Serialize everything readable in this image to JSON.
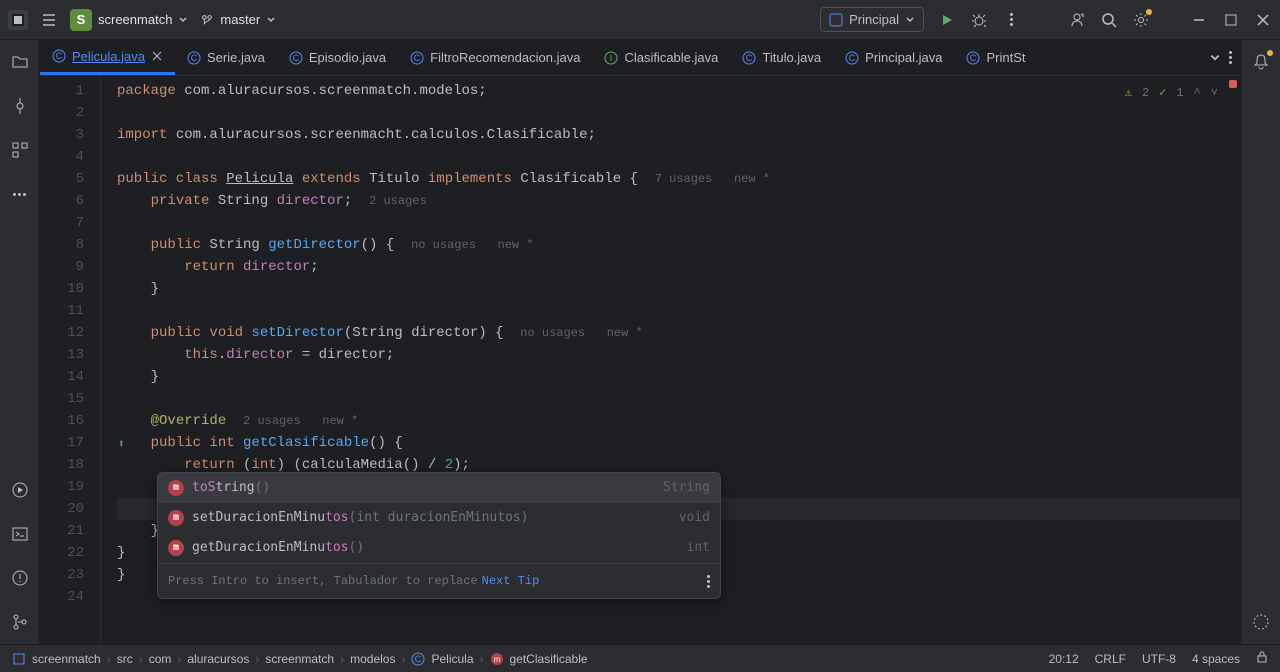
{
  "titlebar": {
    "project_letter": "S",
    "project_name": "screenmatch",
    "branch": "master",
    "run_config": "Principal"
  },
  "tabs": [
    {
      "label": "Pelicula.java",
      "active": true
    },
    {
      "label": "Serie.java",
      "active": false
    },
    {
      "label": "Episodio.java",
      "active": false
    },
    {
      "label": "FiltroRecomendacion.java",
      "active": false
    },
    {
      "label": "Clasificable.java",
      "active": false
    },
    {
      "label": "Titulo.java",
      "active": false
    },
    {
      "label": "Principal.java",
      "active": false
    },
    {
      "label": "PrintSt",
      "active": false
    }
  ],
  "inspections": {
    "warnings": "2",
    "typos": "1"
  },
  "code": {
    "package": "com.aluracursos.screenmatch.modelos",
    "import": "com.aluracursos.screenmacht.calculos.Clasificable",
    "class_name": "Pelicula",
    "extends": "Titulo",
    "implements": "Clasificable",
    "class_hints": "7 usages   new *",
    "field_type": "String",
    "field_name": "director",
    "field_hints": "2 usages",
    "getter_name": "getDirector",
    "getter_hints": "no usages   new *",
    "setter_name": "setDirector",
    "setter_hints": "no usages   new *",
    "override_hints": "2 usages   new *",
    "clasif_name": "getClasificable",
    "calc_name": "calculaMedia",
    "typed": "toS"
  },
  "popup": {
    "items": [
      {
        "match": "toS",
        "rest": "tring",
        "params": "()",
        "ret": "String"
      },
      {
        "match": "",
        "rest": "setDuracionEnMinu",
        "tail": "tos",
        "params": "(int duracionEnMinutos)",
        "ret": "void"
      },
      {
        "match": "",
        "rest": "getDuracionEnMinu",
        "tail": "tos",
        "params": "()",
        "ret": "int"
      }
    ],
    "hint": "Press Intro to insert, Tabulador to replace",
    "link": "Next Tip"
  },
  "breadcrumb": [
    "screenmatch",
    "src",
    "com",
    "aluracursos",
    "screenmatch",
    "modelos",
    "Pelicula",
    "getClasificable"
  ],
  "status": {
    "pos": "20:12",
    "line_sep": "CRLF",
    "encoding": "UTF-8",
    "indent": "4 spaces"
  },
  "line_numbers": [
    "1",
    "2",
    "3",
    "4",
    "5",
    "6",
    "7",
    "8",
    "9",
    "10",
    "11",
    "12",
    "13",
    "14",
    "15",
    "16",
    "17",
    "18",
    "19",
    "20",
    "21",
    "22",
    "23",
    "24"
  ]
}
